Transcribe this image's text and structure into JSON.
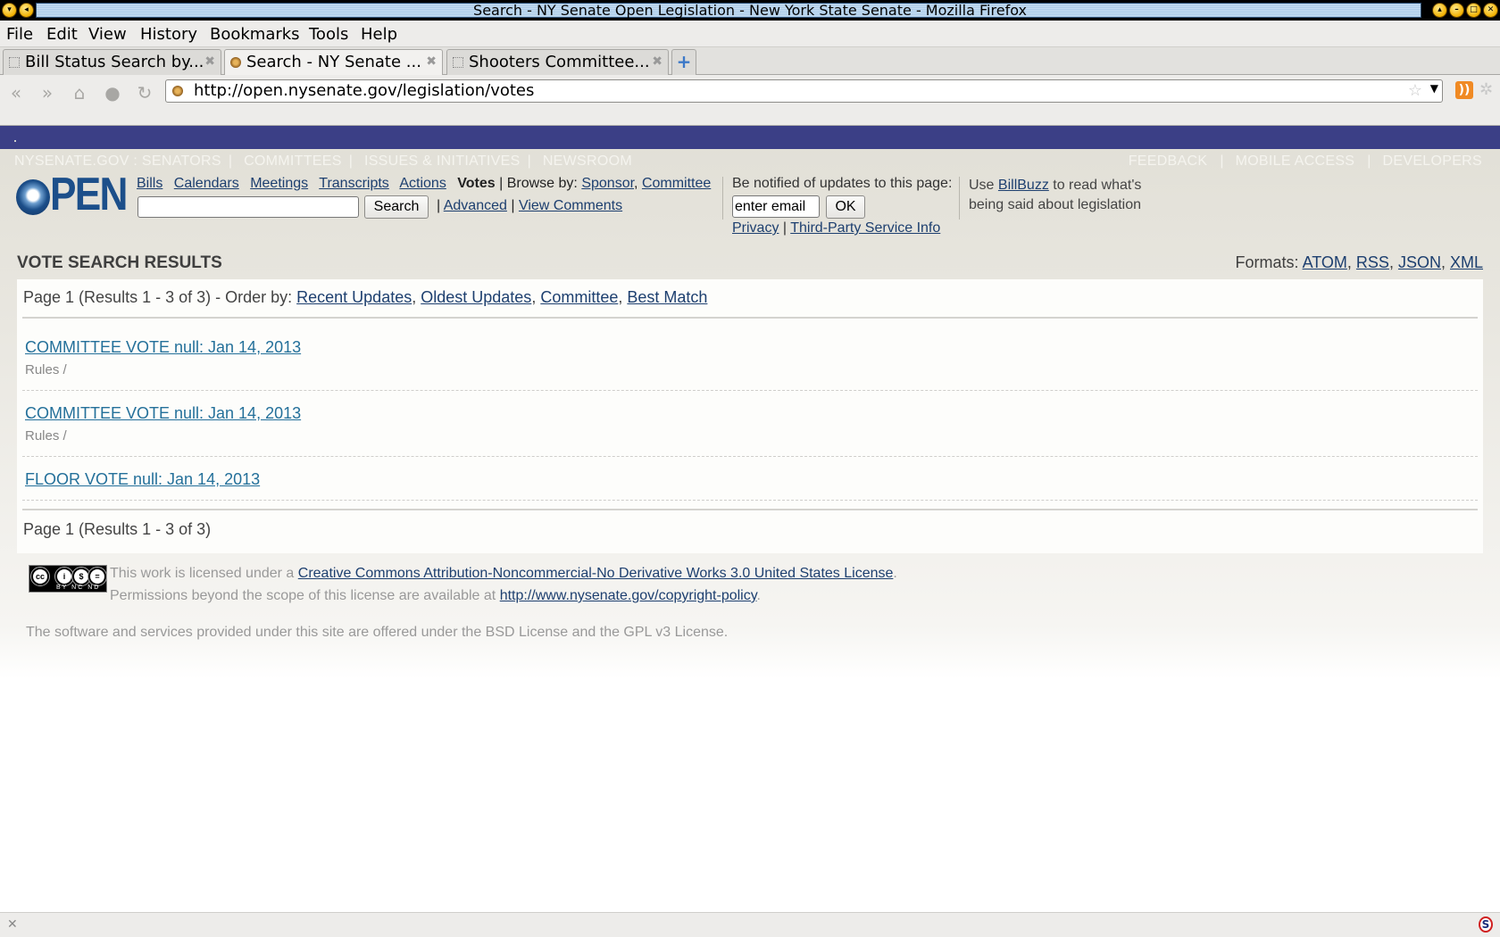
{
  "window": {
    "title": "Search - NY Senate Open Legislation - New York State Senate - Mozilla Firefox"
  },
  "menu": [
    "File",
    "Edit",
    "View",
    "History",
    "Bookmarks",
    "Tools",
    "Help"
  ],
  "tabs": [
    {
      "label": "Bill Status Search by...",
      "active": false
    },
    {
      "label": "Search - NY Senate ...",
      "active": true
    },
    {
      "label": "Shooters Committee...",
      "active": false
    }
  ],
  "navbar": {
    "url": "http://open.nysenate.gov/legislation/votes"
  },
  "site_nav": {
    "left": [
      "NYSENATE.GOV : SENATORS",
      "COMMITTEES",
      "ISSUES & INITIATIVES",
      "NEWSROOM"
    ],
    "right": [
      "FEEDBACK",
      "MOBILE ACCESS",
      "DEVELOPERS"
    ]
  },
  "header": {
    "logo_text": "PEN",
    "links": [
      "Bills",
      "Calendars",
      "Meetings",
      "Transcripts",
      "Actions"
    ],
    "current": "Votes",
    "browse_label": "| Browse by:",
    "browse_links": [
      "Sponsor",
      "Committee"
    ],
    "search_value": "",
    "search_button": "Search",
    "advanced": "Advanced",
    "view_comments": "View Comments",
    "notify_label": "Be notified of updates to this page:",
    "email_placeholder": "enter email",
    "ok_button": "OK",
    "privacy": "Privacy",
    "third_party": "Third-Party Service Info",
    "billbuzz_prefix": "Use",
    "billbuzz_link": "BillBuzz",
    "billbuzz_suffix": "to read what's",
    "billbuzz_line2": "being said about legislation"
  },
  "results_header": {
    "title": "VOTE SEARCH RESULTS",
    "formats_label": "Formats:",
    "formats": [
      "ATOM",
      "RSS",
      "JSON",
      "XML"
    ]
  },
  "results": {
    "summary": "Page 1 (Results 1 - 3 of 3) - Order by:",
    "order_by": [
      "Recent Updates",
      "Oldest Updates",
      "Committee",
      "Best Match"
    ],
    "items": [
      {
        "title": "COMMITTEE VOTE null: Jan 14, 2013",
        "sub": "Rules /"
      },
      {
        "title": "COMMITTEE VOTE null: Jan 14, 2013",
        "sub": "Rules /"
      },
      {
        "title": "FLOOR VOTE null: Jan 14, 2013",
        "sub": ""
      }
    ],
    "pager": "Page 1 (Results 1 - 3 of 3)"
  },
  "footer": {
    "cc_badge": "BY NC ND",
    "license_prefix": "This work is licensed under a",
    "license_link": "Creative Commons Attribution-Noncommercial-No Derivative Works 3.0 United States License",
    "permissions_prefix": "Permissions beyond the scope of this license are available at",
    "permissions_link": "http://www.nysenate.gov/copyright-policy",
    "software": "The software and services provided under this site are offered under the BSD License and the GPL v3 License."
  },
  "colors": {
    "band": "#3b3f86",
    "link": "#1d3f6f",
    "result_link": "#24709a",
    "logo": "#1c4f8a"
  }
}
